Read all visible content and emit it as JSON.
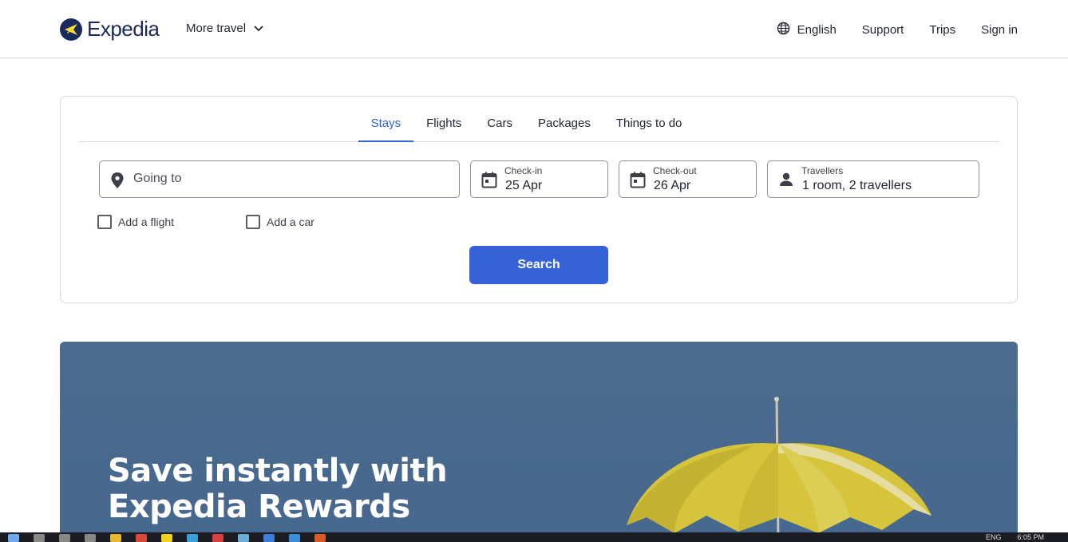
{
  "header": {
    "brand": "Expedia",
    "more_travel": "More travel",
    "nav": {
      "language": "English",
      "support": "Support",
      "trips": "Trips",
      "sign_in": "Sign in"
    }
  },
  "search": {
    "tabs": [
      {
        "label": "Stays",
        "active": true
      },
      {
        "label": "Flights",
        "active": false
      },
      {
        "label": "Cars",
        "active": false
      },
      {
        "label": "Packages",
        "active": false
      },
      {
        "label": "Things to do",
        "active": false
      }
    ],
    "going_to": {
      "placeholder": "Going to",
      "value": ""
    },
    "check_in": {
      "label": "Check-in",
      "value": "25 Apr"
    },
    "check_out": {
      "label": "Check-out",
      "value": "26 Apr"
    },
    "travellers": {
      "label": "Travellers",
      "value": "1 room, 2 travellers"
    },
    "add_flight": {
      "label": "Add a flight",
      "checked": false
    },
    "add_car": {
      "label": "Add a car",
      "checked": false
    },
    "search_button": "Search"
  },
  "hero": {
    "headline_line1": "Save instantly with",
    "headline_line2": "Expedia Rewards"
  },
  "taskbar": {
    "lang": "ENG",
    "time": "6:05 PM"
  },
  "colors": {
    "accent": "#3662d8",
    "brand_navy": "#1a2a5b",
    "brand_yellow": "#fddb32",
    "hero_bg": "#4a6a8e"
  },
  "icons": [
    "expedia-logo-icon",
    "chevron-down-icon",
    "globe-icon",
    "location-pin-icon",
    "calendar-icon",
    "person-icon",
    "checkbox-icon",
    "umbrella-image"
  ]
}
